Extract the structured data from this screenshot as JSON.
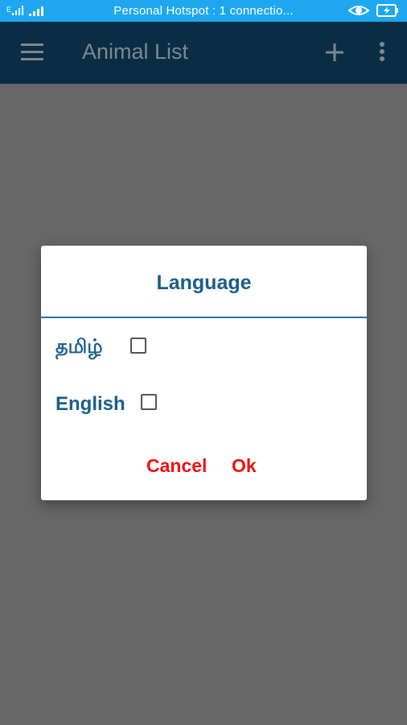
{
  "status_bar": {
    "center_text": "Personal Hotspot : 1 connectio...",
    "icons": [
      "wifi-signal-icon",
      "cell-signal-icon",
      "eye-icon",
      "battery-charging-icon"
    ]
  },
  "app_bar": {
    "menu_icon": "hamburger-menu-icon",
    "title": "Animal List",
    "add_icon": "plus-icon",
    "more_icon": "overflow-menu-icon"
  },
  "dialog": {
    "title": "Language",
    "options": [
      {
        "label": "தமிழ்",
        "checked": false
      },
      {
        "label": "English",
        "checked": false
      }
    ],
    "cancel_label": "Cancel",
    "ok_label": "Ok"
  },
  "colors": {
    "status_bar": "#1ea7ee",
    "app_bar": "#0b2d44",
    "scrim": "#676767",
    "dialog_text": "#1a5d8a",
    "button_text": "#f01212"
  }
}
